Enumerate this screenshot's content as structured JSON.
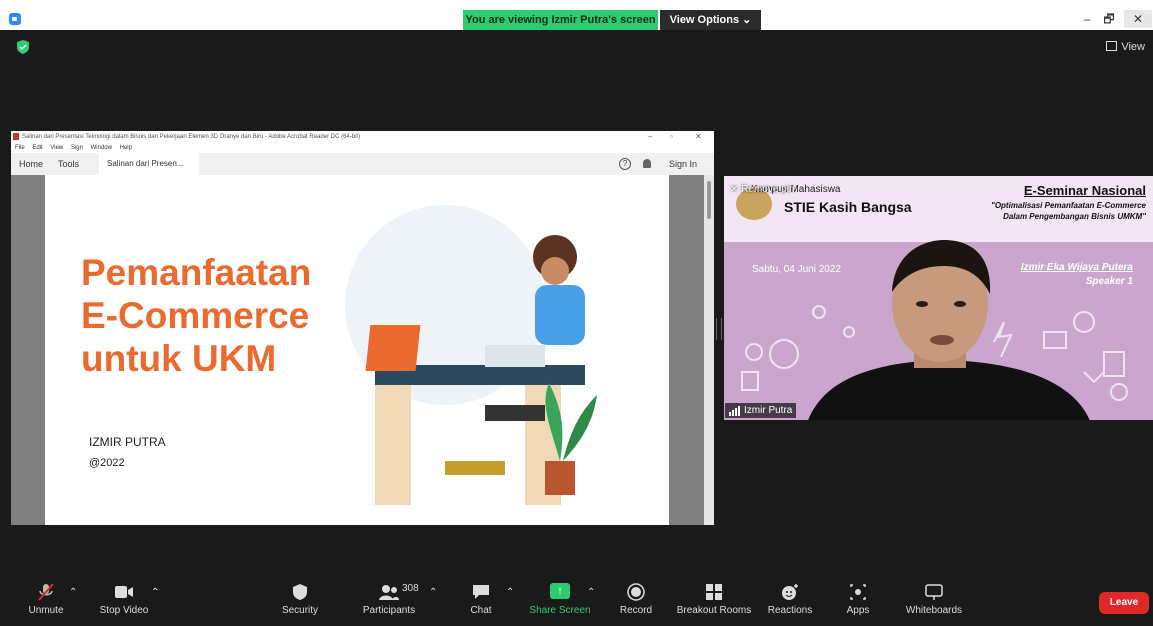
{
  "banner": {
    "viewing_text": "You are viewing Izmir Putra's screen",
    "view_options": "View Options ⌄"
  },
  "window_controls": {
    "minimize": "–",
    "restore": "🗗",
    "close": "✕"
  },
  "meeting": {
    "view_label": "View"
  },
  "acrobat": {
    "title": "Salinan dari Presentasi Teknologi dalam Bisnis dan Pekerjaan Elemen 3D Oranye dan Biru - Adobe Acrobat Reader DC (64-bit)",
    "menu": [
      "File",
      "Edit",
      "View",
      "Sign",
      "Window",
      "Help"
    ],
    "tab_home": "Home",
    "tab_tools": "Tools",
    "tab_document": "Salinan dari Presen...",
    "tab_close": "×",
    "help": "?",
    "sign_in": "Sign In"
  },
  "slide": {
    "title_line1": "Pemanfaatan",
    "title_line2": "E-Commerce",
    "title_line3": "untuk UKM",
    "author": "IZMIR PUTRA",
    "year": "@2022"
  },
  "speaker_video": {
    "remove_pin": "Remove pin",
    "campus": "Kampus Mahasiswa",
    "school": "STIE Kasih Bangsa",
    "seminar_title": "E-Seminar Nasional",
    "seminar_subtitle": "\"Optimalisasi Pemanfaatan E-Commerce Dalam Pengembangan Bisnis UMKM\"",
    "date": "Sabtu, 04 Juni 2022",
    "speaker_name": "Izmir Eka Wijaya Putera",
    "speaker_role": "Speaker 1",
    "participant_name": "Izmir Putra"
  },
  "toolbar": {
    "unmute": "Unmute",
    "stop_video": "Stop Video",
    "security": "Security",
    "participants": "Participants",
    "participants_count": "308",
    "chat": "Chat",
    "share_screen": "Share Screen",
    "record": "Record",
    "breakout_rooms": "Breakout Rooms",
    "reactions": "Reactions",
    "apps": "Apps",
    "whiteboards": "Whiteboards",
    "leave": "Leave"
  },
  "colors": {
    "accent_green": "#2ecc71",
    "leave_red": "#e02828",
    "slide_orange": "#ea6a2f",
    "zoom_blue": "#2d8cff"
  }
}
